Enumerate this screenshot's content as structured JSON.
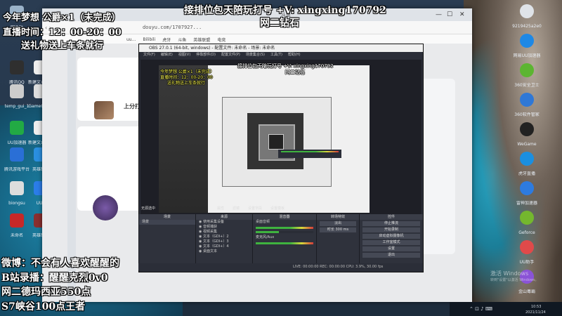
{
  "overlay": {
    "top_left_line1": "今年梦想 公爵×1（未完成）",
    "top_left_line2": "直播时间：12：00-20：00",
    "top_left_line3": "送礼物送上车条就行",
    "top_center_line1": "接排位包天陪玩打号 +V: xingxing170792",
    "top_center_line2": "网二钻石",
    "bottom_left_line1": "微博：不会有人喜欢醒醒的",
    "bottom_left_line2": "B站录播：醒醒克烈0v0",
    "bottom_left_line3": "网二德玛西亚550点",
    "bottom_left_line4": "S7峡谷100点王者"
  },
  "desktop_left": [
    {
      "label": "回收站",
      "icon": "recycle-bin-icon",
      "color": "#9bb3c9"
    },
    {
      "label": "腾讯QQ",
      "icon": "qq-icon",
      "color": "#2f2f2f"
    },
    {
      "label": "新建文本文档",
      "icon": "text-file-icon",
      "color": "#eeeeee"
    },
    {
      "label": "temp_gui_1",
      "icon": "file-icon",
      "color": "#cccccc"
    },
    {
      "label": "GameClient",
      "icon": "file-icon",
      "color": "#dddddd"
    },
    {
      "label": "UU加速器",
      "icon": "uu-accelerator-icon",
      "color": "#22aa44"
    },
    {
      "label": "新建文本文档",
      "icon": "text-file-icon",
      "color": "#eeeeee"
    },
    {
      "label": "腾讯游戏平台",
      "icon": "game-platform-icon",
      "color": "#2a6fd6"
    },
    {
      "label": "英雄联盟",
      "icon": "shield-icon",
      "color": "#2a8fe0"
    },
    {
      "label": "biongsu",
      "icon": "file-icon",
      "color": "#dddddd"
    },
    {
      "label": "UU1",
      "icon": "uu-icon",
      "color": "#2b7de9"
    },
    {
      "label": "未命名",
      "icon": "character-icon",
      "color": "#c62828"
    },
    {
      "label": "英雄联盟",
      "icon": "shield-icon",
      "color": "#8a2f2f"
    }
  ],
  "desktop_right": [
    {
      "label": "9219425a2e0",
      "icon": "doc-icon",
      "color": "#dfe3e8"
    },
    {
      "label": "网易UU加速器",
      "icon": "power-icon",
      "color": "#1e88e5"
    },
    {
      "label": "360安全卫士",
      "icon": "shield-360-icon",
      "color": "#5cb531"
    },
    {
      "label": "360软件管家",
      "icon": "software-icon",
      "color": "#2f78d6"
    },
    {
      "label": "WeGame",
      "icon": "wegame-icon",
      "color": "#222222"
    },
    {
      "label": "虎牙直播",
      "icon": "huya-icon",
      "color": "#1b8fe0"
    },
    {
      "label": "雷神加速器",
      "icon": "thunder-icon",
      "color": "#2d7be0"
    },
    {
      "label": "Geforce",
      "icon": "geforce-icon",
      "color": "#74b72e"
    },
    {
      "label": "UU助手",
      "icon": "uu-helper-icon",
      "color": "#e04a4a"
    },
    {
      "label": "金山毒霸",
      "icon": "kingsoft-icon",
      "color": "#8a53d6"
    }
  ],
  "browser": {
    "url": "douyu.com/1707927...",
    "tab_label": "斗鱼",
    "bookmarks": [
      "uu...",
      "Bilibili",
      "虎牙",
      "斗鱼",
      "英雄联盟",
      "电竞"
    ],
    "left_number": "12",
    "upper_label": "上分打"
  },
  "obs": {
    "title": "OBS 27.0.1 (64-bit, windows) - 配置文件: 未命名 - 场景: 未命名",
    "menu": [
      "文件(F)",
      "编辑(E)",
      "视图(V)",
      "停靠部件(D)",
      "配置文件(P)",
      "场景集合(S)",
      "工具(T)",
      "帮助(H)"
    ],
    "no_source": "无源选中",
    "prop_buttons": [
      "属性",
      "滤镜",
      "设置字段",
      "设置模板"
    ],
    "dock_titles": [
      "场景",
      "来源",
      "混音器",
      "转场特效",
      "控件"
    ],
    "scenes": [
      "场景"
    ],
    "sources": [
      "使用采集设备",
      "音频捕获",
      "视频采集",
      "文本（GDI+）2",
      "文本（GDI+）3",
      "文本（GDI+）4",
      "桌面文本"
    ],
    "mixer": [
      "桌面音频",
      "麦克风/Aux"
    ],
    "transition": [
      "淡出",
      "时长 300 ms"
    ],
    "controls": [
      "停止推流",
      "开始录制",
      "启动虚拟摄像机",
      "工作室模式",
      "设置",
      "退出"
    ],
    "status": "LIVE: 00:00:00   REC: 00:00:00   CPU: 3.9%, 30.00 fps"
  },
  "tray": {
    "time": "10:53",
    "date": "2021/11/24",
    "watermark": "激活 Windows",
    "watermark_sub": "转到\"设置\"以激活 Windows。"
  }
}
